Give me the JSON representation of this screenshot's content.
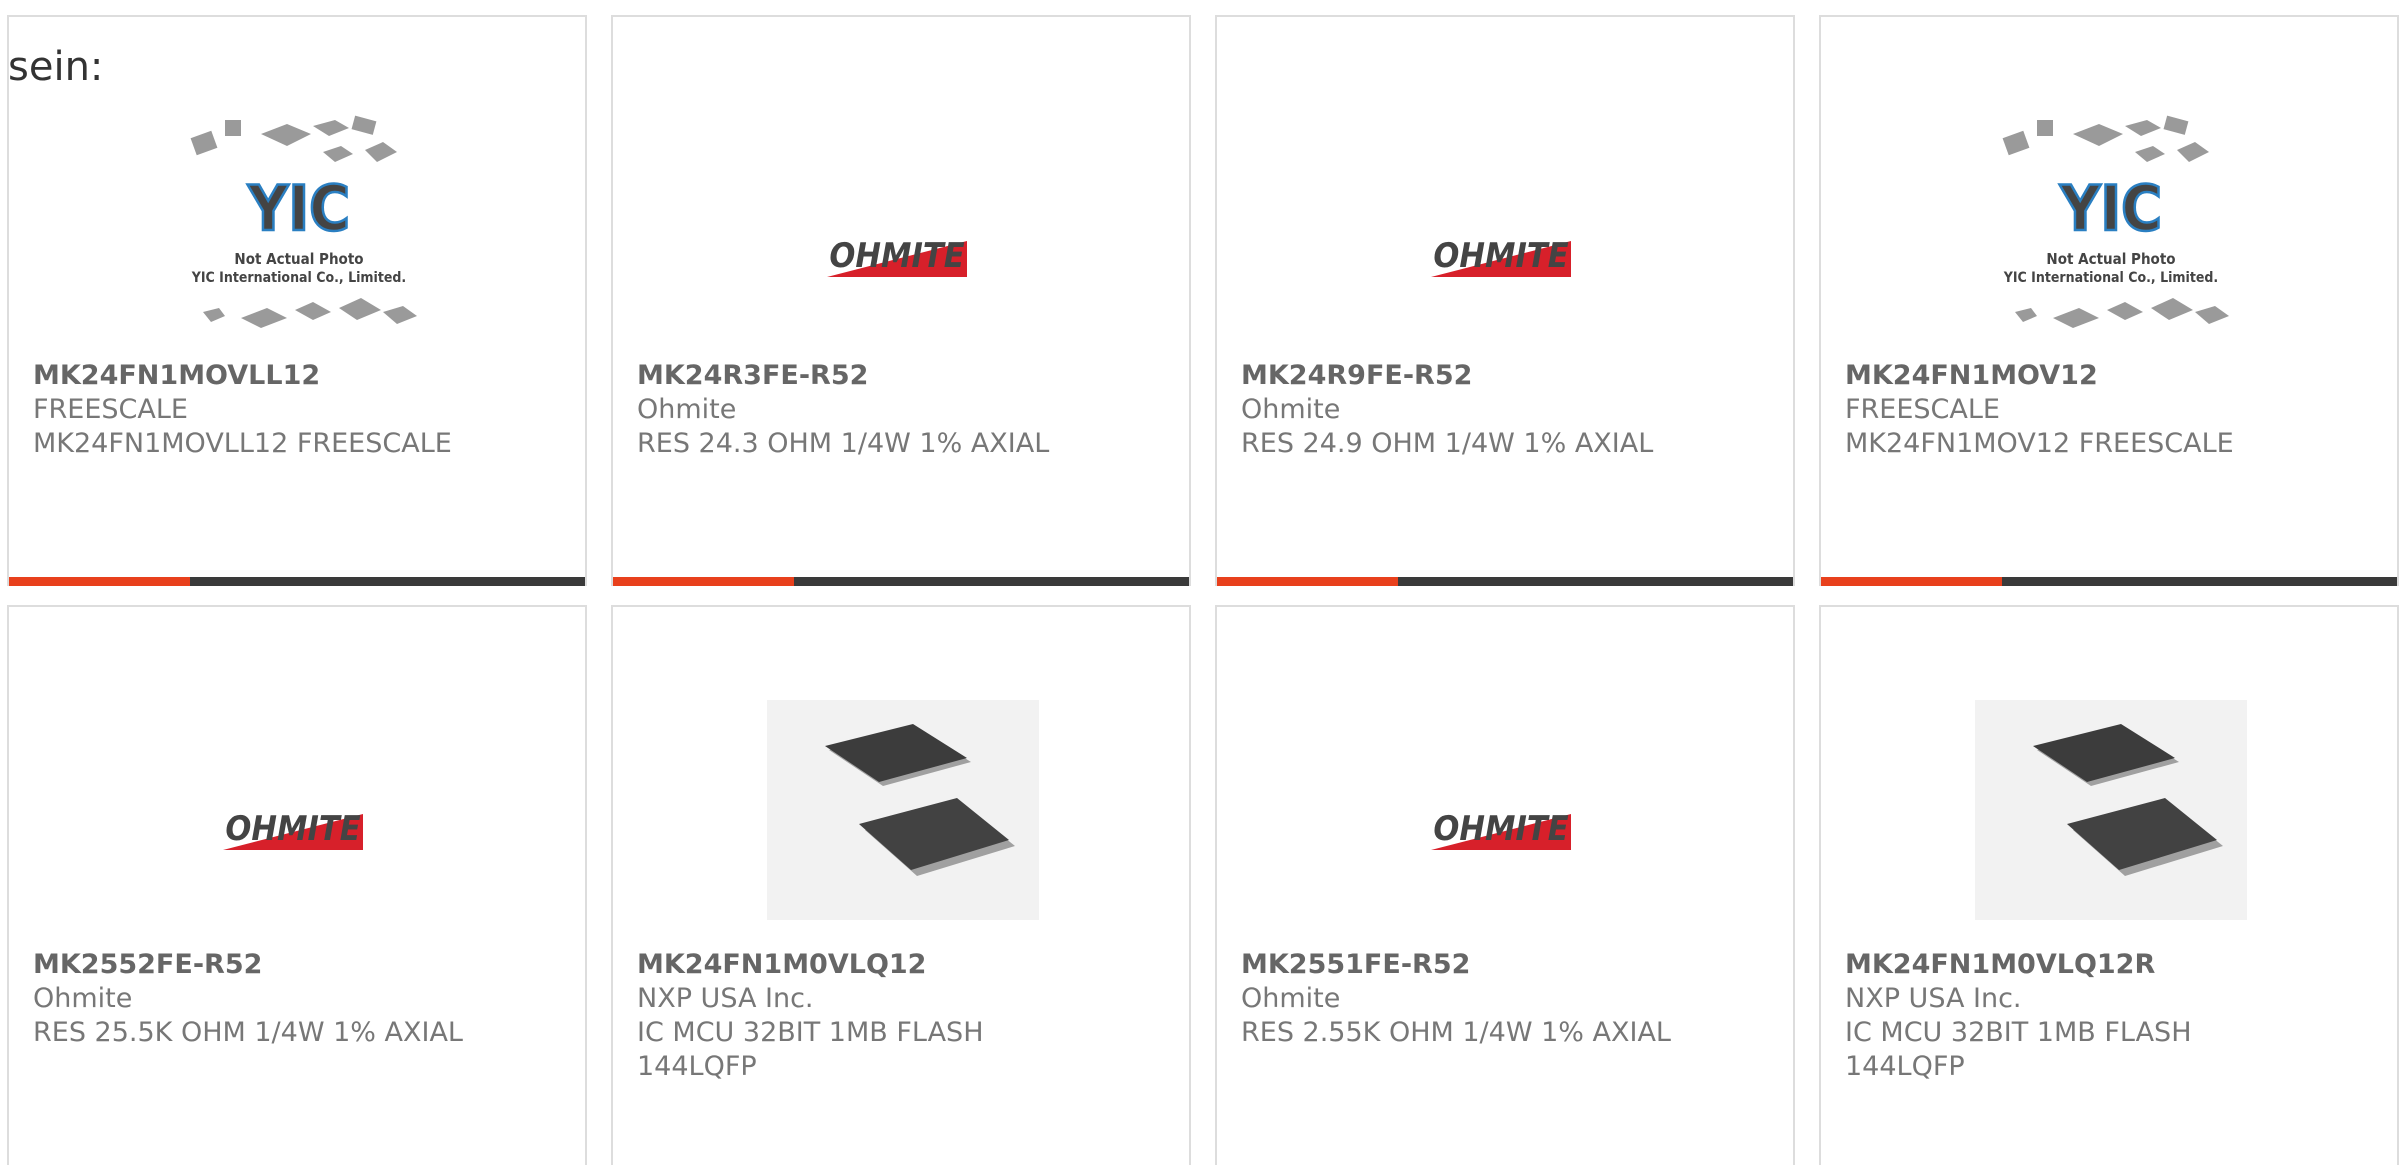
{
  "intro_text": "sein:",
  "colors": {
    "accent": "#e8401c",
    "bar": "#3a3a3a",
    "ohmite_red": "#d7202a"
  },
  "image_labels": {
    "ohmite_logo": "OHMITE",
    "yic_logo": "YIC",
    "yic_line1": "Not Actual Photo",
    "yic_line2": "YIC International Co., Limited."
  },
  "products": [
    {
      "part": "MK24FN1MOVLL12",
      "maker": "FREESCALE",
      "desc": "MK24FN1MOVLL12 FREESCALE",
      "image": "yic-placeholder"
    },
    {
      "part": "MK24R3FE-R52",
      "maker": "Ohmite",
      "desc": "RES 24.3 OHM 1/4W 1% AXIAL",
      "image": "ohmite-logo"
    },
    {
      "part": "MK24R9FE-R52",
      "maker": "Ohmite",
      "desc": "RES 24.9 OHM 1/4W 1% AXIAL",
      "image": "ohmite-logo"
    },
    {
      "part": "MK24FN1MOV12",
      "maker": "FREESCALE",
      "desc": "MK24FN1MOV12 FREESCALE",
      "image": "yic-placeholder"
    },
    {
      "part": "MK2552FE-R52",
      "maker": "Ohmite",
      "desc": "RES 25.5K OHM 1/4W 1% AXIAL",
      "image": "ohmite-logo"
    },
    {
      "part": "MK24FN1M0VLQ12",
      "maker": "NXP USA Inc.",
      "desc": "IC MCU 32BIT 1MB FLASH 144LQFP",
      "image": "lqfp-chip"
    },
    {
      "part": "MK2551FE-R52",
      "maker": "Ohmite",
      "desc": "RES 2.55K OHM 1/4W 1% AXIAL",
      "image": "ohmite-logo"
    },
    {
      "part": "MK24FN1M0VLQ12R",
      "maker": "NXP USA Inc.",
      "desc": "IC MCU 32BIT 1MB FLASH 144LQFP",
      "image": "lqfp-chip"
    }
  ]
}
